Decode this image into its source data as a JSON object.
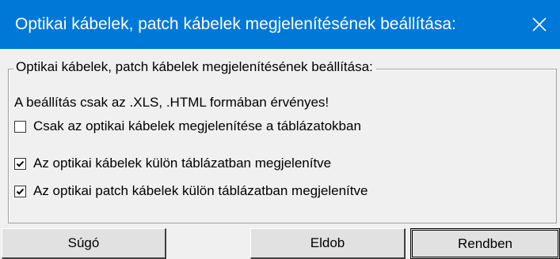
{
  "window": {
    "title": "Optikai kábelek, patch kábelek megjelenítésének beállítása:",
    "close_icon": "close-icon",
    "titlebar_color": "#0078d7"
  },
  "group": {
    "legend": "Optikai kábelek, patch kábelek megjelenítésének beállítása:",
    "info": "A beállítás csak az .XLS, .HTML formában érvényes!",
    "options": [
      {
        "label": "Csak az optikai kábelek megjelenítése a táblázatokban",
        "checked": false
      },
      {
        "label": "Az optikai kábelek külön táblázatban megjelenítve",
        "checked": true
      },
      {
        "label": "Az optikai patch kábelek külön táblázatban megjelenítve",
        "checked": true
      }
    ]
  },
  "buttons": {
    "help": "Súgó",
    "discard": "Eldob",
    "ok": "Rendben"
  }
}
